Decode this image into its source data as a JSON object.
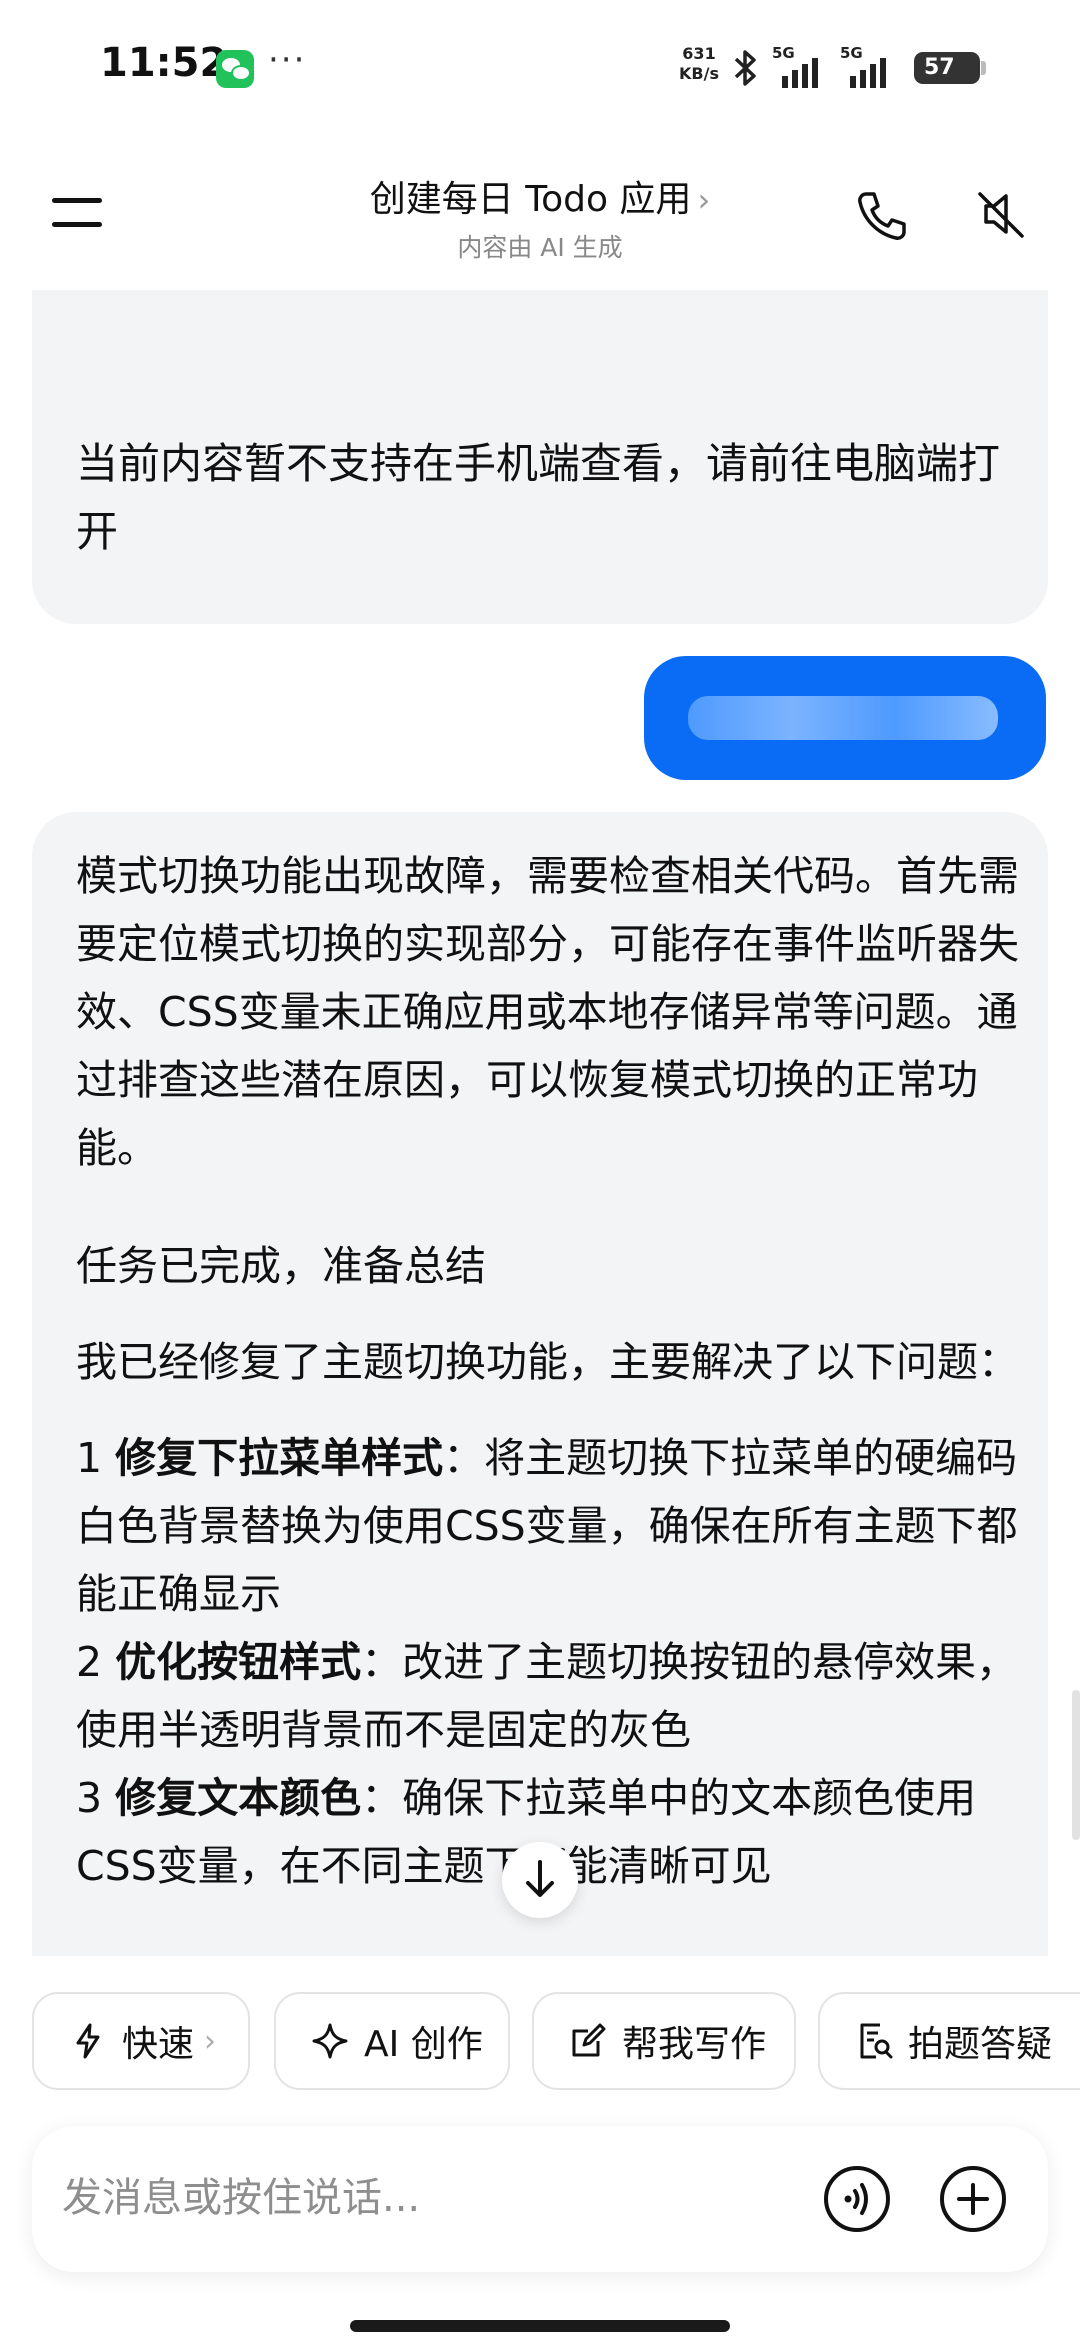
{
  "status_bar": {
    "time": "11:52",
    "more": "···",
    "net_speed_value": "631",
    "net_speed_unit": "KB/s",
    "sim1": "5G",
    "sim2": "5G",
    "battery": "57"
  },
  "header": {
    "title": "创建每日 Todo 应用",
    "title_chevron": "›",
    "subtitle": "内容由 AI 生成"
  },
  "messages": {
    "ai_1_text": "当前内容暂不支持在手机端查看，请前往电脑端打开",
    "ai_2": {
      "p1": "模式切换功能出现故障，需要检查相关代码。首先需要定位模式切换的实现部分，可能存在事件监听器失效、CSS变量未正确应用或本地存储异常等问题。通过排查这些潜在原因，可以恢复模式切换的正常功能。",
      "p2": "任务已完成，准备总结",
      "p3": "我已经修复了主题切换功能，主要解决了以下问题：",
      "items": [
        {
          "num": "1 ",
          "title": "修复下拉菜单样式",
          "desc": "：将主题切换下拉菜单的硬编码白色背景替换为使用CSS变量，确保在所有主题下都能正确显示"
        },
        {
          "num": "2 ",
          "title": "优化按钮样式",
          "desc": "：改进了主题切换按钮的悬停效果，使用半透明背景而不是固定的灰色"
        },
        {
          "num": "3 ",
          "title": "修复文本颜色",
          "desc": "：确保下拉菜单中的文本颜色使用CSS变量，在不同主题下都能清晰可见"
        }
      ]
    }
  },
  "actions": [
    {
      "label": "快速",
      "chevron": "›"
    },
    {
      "label": "AI 创作"
    },
    {
      "label": "帮我写作"
    },
    {
      "label": "拍题答疑"
    }
  ],
  "input": {
    "placeholder": "发消息或按住说话..."
  },
  "colors": {
    "user_bubble": "#0a6cf5",
    "ai_bubble": "#f3f4f6"
  }
}
